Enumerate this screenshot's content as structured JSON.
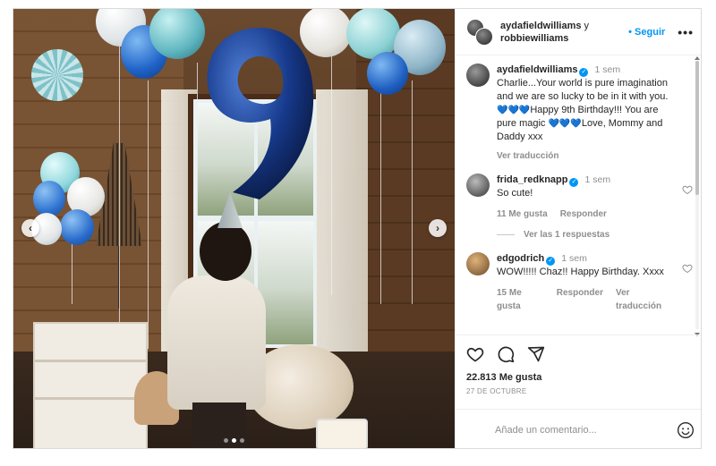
{
  "header": {
    "user1": "aydafieldwilliams",
    "joiner": "y",
    "user2": "robbiewilliams",
    "follow_label": "Seguir",
    "more_label": "•••"
  },
  "caption": {
    "user": "aydafieldwilliams",
    "time": "1 sem",
    "text_before": "Charlie...Your world is pure imagination and we are so lucky to be in it with you. ",
    "hearts1": "💙💙💙",
    "text_middle": "Happy 9th Birthday!!! You are pure magic ",
    "hearts2": "💙💙💙",
    "text_after": "Love, Mommy and Daddy xxx",
    "translate_label": "Ver traducción"
  },
  "comments": [
    {
      "user": "frida_redknapp",
      "time": "1 sem",
      "text": "So cute!",
      "likes": "11 Me gusta",
      "reply_label": "Responder",
      "replies_label": "Ver las 1 respuestas"
    },
    {
      "user": "edgodrich",
      "time": "1 sem",
      "text": "WOW!!!!! Chaz!! Happy Birthday. Xxxx",
      "likes": "15 Me gusta",
      "reply_label": "Responder",
      "translate_label": "Ver traducción"
    }
  ],
  "post": {
    "likes": "22.813 Me gusta",
    "date": "27 DE OCTUBRE",
    "carousel_slides": 3,
    "carousel_active": 2
  },
  "composer": {
    "placeholder": "Añade un comentario..."
  },
  "icons": {
    "heart": "heart-icon",
    "comment": "comment-icon",
    "share": "share-icon",
    "emoji": "emoji-icon",
    "verified": "verified-icon"
  },
  "colors": {
    "accent": "#0095f6",
    "muted": "#8e8e8e",
    "text": "#262626"
  }
}
